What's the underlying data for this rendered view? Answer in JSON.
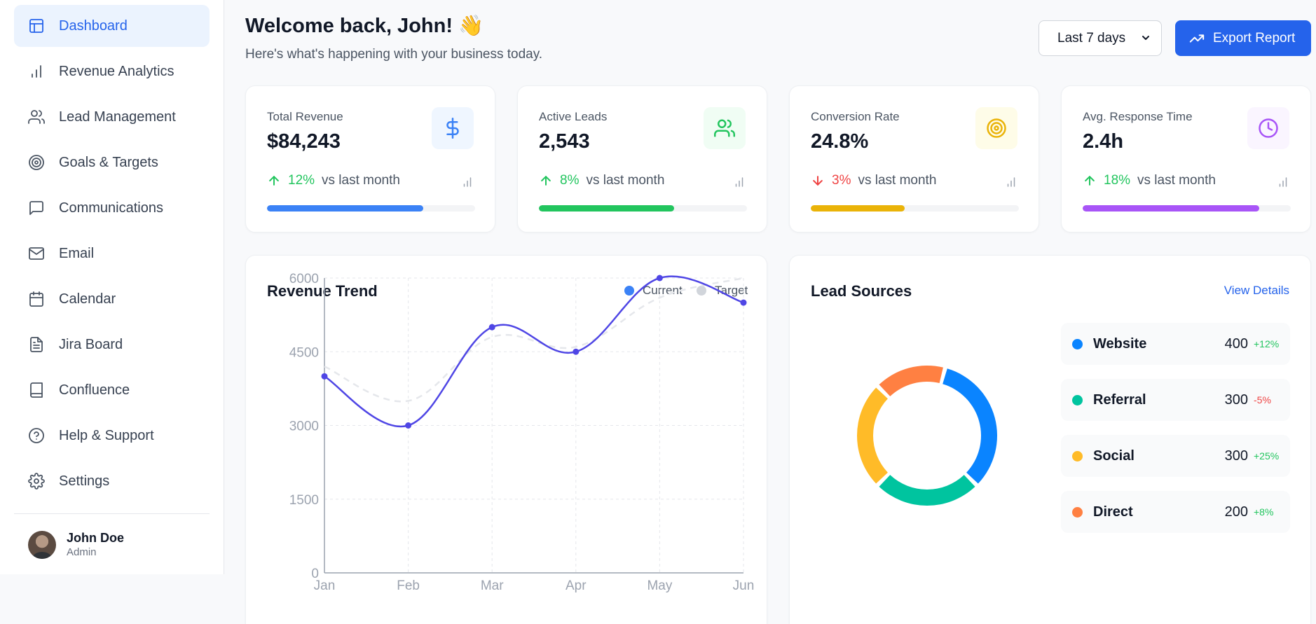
{
  "colors": {
    "accent": "#2563eb",
    "positive": "#22c55e",
    "negative": "#ef4444",
    "nav_active_bg": "#ebf3fe"
  },
  "sidebar": {
    "items": [
      {
        "label": "Dashboard",
        "icon": "layout-icon",
        "active": true
      },
      {
        "label": "Revenue Analytics",
        "icon": "bar-chart-icon",
        "active": false
      },
      {
        "label": "Lead Management",
        "icon": "users-icon",
        "active": false
      },
      {
        "label": "Goals & Targets",
        "icon": "target-icon",
        "active": false
      },
      {
        "label": "Communications",
        "icon": "message-square-icon",
        "active": false
      },
      {
        "label": "Email",
        "icon": "mail-icon",
        "active": false
      },
      {
        "label": "Calendar",
        "icon": "calendar-icon",
        "active": false
      },
      {
        "label": "Jira Board",
        "icon": "file-text-icon",
        "active": false
      },
      {
        "label": "Confluence",
        "icon": "book-icon",
        "active": false
      },
      {
        "label": "Help & Support",
        "icon": "help-circle-icon",
        "active": false
      },
      {
        "label": "Settings",
        "icon": "settings-icon",
        "active": false
      }
    ],
    "user": {
      "name": "John Doe",
      "role": "Admin"
    }
  },
  "header": {
    "welcome": "Welcome back, John! 👋",
    "subtitle": "Here's what's happening with your business today.",
    "range_selected": "Last 7 days",
    "export_label": "Export Report"
  },
  "stats": [
    {
      "label": "Total Revenue",
      "value": "$84,243",
      "change": "12%",
      "direction": "up",
      "vs": "vs last month",
      "icon": "dollar-icon",
      "color": "#3b82f6",
      "icon_bg": "#eff6ff",
      "progress": 0.75
    },
    {
      "label": "Active Leads",
      "value": "2,543",
      "change": "8%",
      "direction": "up",
      "vs": "vs last month",
      "icon": "users-icon",
      "color": "#22c55e",
      "icon_bg": "#f0fdf4",
      "progress": 0.65
    },
    {
      "label": "Conversion Rate",
      "value": "24.8%",
      "change": "3%",
      "direction": "down",
      "vs": "vs last month",
      "icon": "target-icon",
      "color": "#eab308",
      "icon_bg": "#fefce8",
      "progress": 0.45
    },
    {
      "label": "Avg. Response Time",
      "value": "2.4h",
      "change": "18%",
      "direction": "up",
      "vs": "vs last month",
      "icon": "clock-icon",
      "color": "#a855f7",
      "icon_bg": "#faf5ff",
      "progress": 0.85
    }
  ],
  "revenue_trend": {
    "title": "Revenue Trend",
    "legend": [
      {
        "name": "Current",
        "color": "#3b82f6"
      },
      {
        "name": "Target",
        "color": "#d1d5db"
      }
    ]
  },
  "chart_data": {
    "type": "line",
    "categories": [
      "Jan",
      "Feb",
      "Mar",
      "Apr",
      "May",
      "Jun"
    ],
    "series": [
      {
        "name": "Current",
        "values": [
          4000,
          3000,
          5000,
          4500,
          6000,
          5500
        ],
        "color": "#4f46e5"
      },
      {
        "name": "Target",
        "values": [
          4200,
          3500,
          4800,
          4600,
          5600,
          6000
        ],
        "color": "#e5e7eb",
        "dashed": true
      }
    ],
    "y_ticks": [
      0,
      1500,
      3000,
      4500,
      6000
    ],
    "ylim": [
      0,
      6000
    ],
    "grid": true
  },
  "lead_sources": {
    "title": "Lead Sources",
    "view_details": "View Details",
    "items": [
      {
        "name": "Website",
        "value": 400,
        "change": "+12%",
        "positive": true,
        "color": "#0a84ff"
      },
      {
        "name": "Referral",
        "value": 300,
        "change": "-5%",
        "positive": false,
        "color": "#00c49f"
      },
      {
        "name": "Social",
        "value": 300,
        "change": "+25%",
        "positive": true,
        "color": "#ffbb28"
      },
      {
        "name": "Direct",
        "value": 200,
        "change": "+8%",
        "positive": true,
        "color": "#ff8042"
      }
    ]
  }
}
